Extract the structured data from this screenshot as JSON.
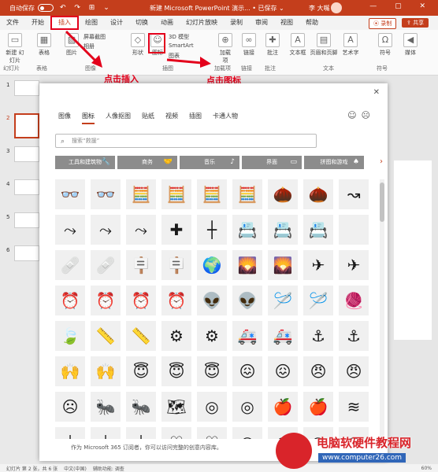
{
  "titlebar": {
    "autosave": "自动保存",
    "doc_title": "新建 Microsoft PowerPoint 演示... • 已保存 ⌄",
    "user": "李 大嘴",
    "winctl": "— ▢ ✕",
    "qa_icons": "↶ ↷ ⊞ ⌄"
  },
  "tabs": [
    "文件",
    "开始",
    "插入",
    "绘图",
    "设计",
    "切换",
    "动画",
    "幻灯片放映",
    "录制",
    "审阅",
    "视图",
    "帮助"
  ],
  "active_tab": "插入",
  "rec_label": "⦿ 录制",
  "share_label": "⇪ 共享",
  "ribbon": {
    "new_slide": "新建\n幻灯片",
    "table": "表格",
    "pictures": "图片",
    "screenshot": "屏幕截图",
    "album": "相册",
    "shapes": "形状",
    "icons": "图标",
    "model3d": "3D 模型",
    "smartart": "SmartArt",
    "chart": "图表",
    "addins": "加载项",
    "link": "链接",
    "comment": "批注",
    "textbox": "文本框",
    "header": "页眉和页脚",
    "wordart": "艺术字",
    "symbol": "符号",
    "media": "媒体",
    "groups": {
      "slides": "幻灯片",
      "tables": "表格",
      "images": "图像",
      "illus": "插图",
      "addin": "加载项",
      "links": "链接",
      "comments": "批注",
      "text": "文本",
      "symbols": "符号"
    }
  },
  "annotations": {
    "insert": "点击插入",
    "icons": "点击图标"
  },
  "thumbs": [
    "1",
    "2",
    "3",
    "4",
    "5",
    "6"
  ],
  "dialog": {
    "tabs": [
      "图像",
      "图标",
      "人像抠图",
      "贴纸",
      "视频",
      "插图",
      "卡通人物"
    ],
    "active_tab": "图标",
    "search_placeholder": "搜索“救援”",
    "categories": [
      {
        "label": "工具和建筑物",
        "icon": "🔧"
      },
      {
        "label": "商务",
        "icon": "🤝"
      },
      {
        "label": "音乐",
        "icon": "♪"
      },
      {
        "label": "界面",
        "icon": "▭"
      },
      {
        "label": "拼图和游戏",
        "icon": "♠"
      }
    ],
    "footer": "作为 Microsoft 365 订阅者，你可以访问完整的创意内容库。",
    "cancel": "取消"
  },
  "icon_grid": [
    [
      "👓",
      "👓",
      "🧮",
      "🧮",
      "🧮",
      "🧮",
      "🌰",
      "🌰",
      "↝"
    ],
    [
      "⤳",
      "⤳",
      "⤳",
      "✚",
      "┼",
      "📇",
      "📇",
      "📇",
      ""
    ],
    [
      "🩹",
      "🩹",
      "🪧",
      "🪧",
      "🌍",
      "🌄",
      "🌄",
      "✈",
      "✈"
    ],
    [
      "⏰",
      "⏰",
      "⏰",
      "⏰",
      "👽",
      "👽",
      "🪡",
      "🪡",
      "🧶"
    ],
    [
      "🍃",
      "📏",
      "📏",
      "⚙",
      "⚙",
      "🚑",
      "🚑",
      "⚓",
      "⚓"
    ],
    [
      "🙌",
      "🙌",
      "😇",
      "😇",
      "😇",
      "😖",
      "😖",
      "😠",
      "😠"
    ],
    [
      "☹",
      "🐜",
      "🐜",
      "🗺",
      "◎",
      "◎",
      "🍎",
      "🍎",
      "≋"
    ],
    [
      "⏚",
      "⏚",
      "⏚",
      "♡",
      "♡",
      "◠",
      "◠",
      "◠",
      "◠"
    ]
  ],
  "statusbar": {
    "slide_info": "幻灯片 第 2 张，共 6 张",
    "lang": "中文(中国)",
    "accessibility": "辅助功能: 调查",
    "zoom": "60%"
  },
  "watermark": {
    "text": "电脑软硬件教程网",
    "url": "www.computer26.com"
  }
}
